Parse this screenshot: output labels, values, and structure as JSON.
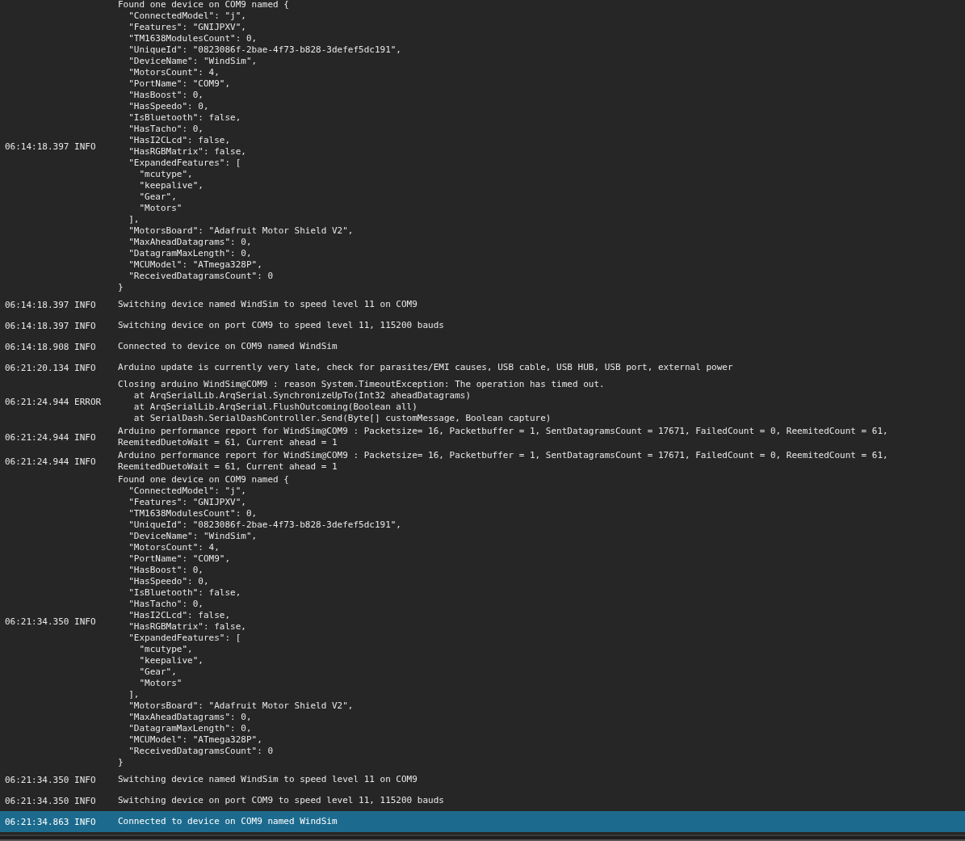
{
  "log": [
    {
      "time": "06:14:18.397",
      "level": "INFO",
      "selected": false,
      "message": "Found one device on COM9 named {\n  \"ConnectedModel\": \"j\",\n  \"Features\": \"GNIJPXV\",\n  \"TM1638ModulesCount\": 0,\n  \"UniqueId\": \"0823086f-2bae-4f73-b828-3defef5dc191\",\n  \"DeviceName\": \"WindSim\",\n  \"MotorsCount\": 4,\n  \"PortName\": \"COM9\",\n  \"HasBoost\": 0,\n  \"HasSpeedo\": 0,\n  \"IsBluetooth\": false,\n  \"HasTacho\": 0,\n  \"HasI2CLcd\": false,\n  \"HasRGBMatrix\": false,\n  \"ExpandedFeatures\": [\n    \"mcutype\",\n    \"keepalive\",\n    \"Gear\",\n    \"Motors\"\n  ],\n  \"MotorsBoard\": \"Adafruit Motor Shield V2\",\n  \"MaxAheadDatagrams\": 0,\n  \"DatagramMaxLength\": 0,\n  \"MCUModel\": \"ATmega328P\",\n  \"ReceivedDatagramsCount\": 0\n}"
    },
    {
      "time": "06:14:18.397",
      "level": "INFO",
      "selected": false,
      "message": "Switching device named WindSim to speed level 11 on COM9"
    },
    {
      "time": "06:14:18.397",
      "level": "INFO",
      "selected": false,
      "message": "Switching device on port COM9 to speed level 11, 115200 bauds"
    },
    {
      "time": "06:14:18.908",
      "level": "INFO",
      "selected": false,
      "message": "Connected to device on COM9 named WindSim"
    },
    {
      "time": "06:21:20.134",
      "level": "INFO",
      "selected": false,
      "message": "Arduino update is currently very late, check for parasites/EMI causes, USB cable, USB HUB, USB port, external power"
    },
    {
      "time": "06:21:24.944",
      "level": "ERROR",
      "selected": false,
      "message": "Closing arduino WindSim@COM9 : reason System.TimeoutException: The operation has timed out.\n   at ArqSerialLib.ArqSerial.SynchronizeUpTo(Int32 aheadDatagrams)\n   at ArqSerialLib.ArqSerial.FlushOutcoming(Boolean all)\n   at SerialDash.SerialDashController.Send(Byte[] customMessage, Boolean capture)"
    },
    {
      "time": "06:21:24.944",
      "level": "INFO",
      "selected": false,
      "message": "Arduino performance report for WindSim@COM9 : Packetsize= 16, Packetbuffer = 1, SentDatagramsCount = 17671, FailedCount = 0, ReemitedCount = 61,\nReemitedDuetoWait = 61, Current ahead = 1"
    },
    {
      "time": "06:21:24.944",
      "level": "INFO",
      "selected": false,
      "message": "Arduino performance report for WindSim@COM9 : Packetsize= 16, Packetbuffer = 1, SentDatagramsCount = 17671, FailedCount = 0, ReemitedCount = 61,\nReemitedDuetoWait = 61, Current ahead = 1"
    },
    {
      "time": "06:21:34.350",
      "level": "INFO",
      "selected": false,
      "message": "Found one device on COM9 named {\n  \"ConnectedModel\": \"j\",\n  \"Features\": \"GNIJPXV\",\n  \"TM1638ModulesCount\": 0,\n  \"UniqueId\": \"0823086f-2bae-4f73-b828-3defef5dc191\",\n  \"DeviceName\": \"WindSim\",\n  \"MotorsCount\": 4,\n  \"PortName\": \"COM9\",\n  \"HasBoost\": 0,\n  \"HasSpeedo\": 0,\n  \"IsBluetooth\": false,\n  \"HasTacho\": 0,\n  \"HasI2CLcd\": false,\n  \"HasRGBMatrix\": false,\n  \"ExpandedFeatures\": [\n    \"mcutype\",\n    \"keepalive\",\n    \"Gear\",\n    \"Motors\"\n  ],\n  \"MotorsBoard\": \"Adafruit Motor Shield V2\",\n  \"MaxAheadDatagrams\": 0,\n  \"DatagramMaxLength\": 0,\n  \"MCUModel\": \"ATmega328P\",\n  \"ReceivedDatagramsCount\": 0\n}"
    },
    {
      "time": "06:21:34.350",
      "level": "INFO",
      "selected": false,
      "message": "Switching device named WindSim to speed level 11 on COM9"
    },
    {
      "time": "06:21:34.350",
      "level": "INFO",
      "selected": false,
      "message": "Switching device on port COM9 to speed level 11, 115200 bauds"
    },
    {
      "time": "06:21:34.863",
      "level": "INFO",
      "selected": true,
      "message": "Connected to device on COM9 named WindSim"
    }
  ]
}
